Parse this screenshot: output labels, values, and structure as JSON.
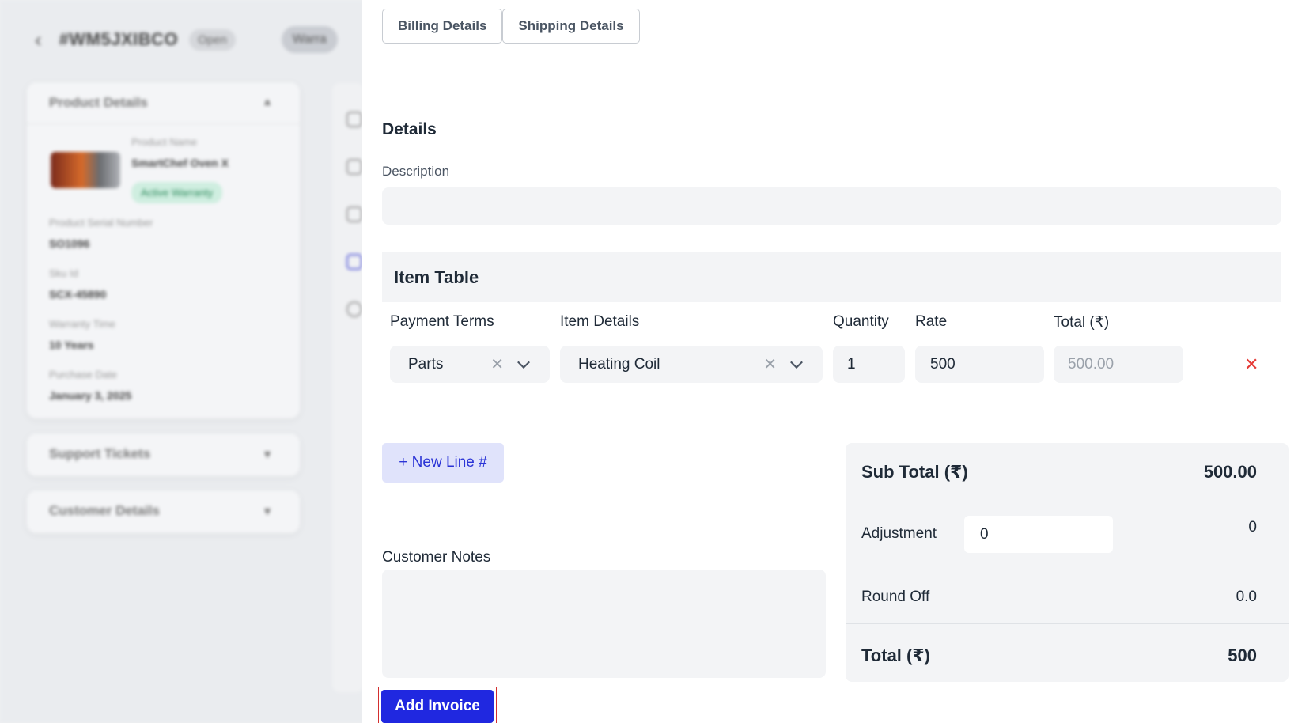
{
  "background": {
    "ticket_id": "#WM5JXIBCO",
    "status": "Open",
    "warranty_pill": "Warra",
    "product_card": {
      "title": "Product Details",
      "product_name_label": "Product Name",
      "product_name": "SmartChef Oven X",
      "warranty_badge": "Active Warranty",
      "serial_label": "Product Serial Number",
      "serial": "SO1096",
      "sku_label": "Sku Id",
      "sku": "SCX-45890",
      "warranty_time_label": "Warranty Time",
      "warranty_time": "10 Years",
      "purchase_date_label": "Purchase Date",
      "purchase_date": "January 3, 2025"
    },
    "support_card_title": "Support Tickets",
    "customer_card_title": "Customer Details"
  },
  "tabs": [
    {
      "label": "Billing Details"
    },
    {
      "label": "Shipping Details"
    }
  ],
  "details": {
    "title": "Details",
    "description_label": "Description",
    "description_value": ""
  },
  "item_table": {
    "title": "Item Table",
    "columns": [
      "Payment Terms",
      "Item Details",
      "Quantity",
      "Rate",
      "Total (₹)"
    ],
    "row": {
      "payment_terms": "Parts",
      "item_details": "Heating Coil",
      "quantity": "1",
      "rate": "500",
      "total": "500.00"
    },
    "remove_symbol": "✕"
  },
  "new_line_label": "+ New Line #",
  "customer_notes": {
    "label": "Customer Notes",
    "value": ""
  },
  "add_invoice_label": "Add Invoice",
  "summary": {
    "subtotal_label": "Sub Total (₹)",
    "subtotal_value": "500.00",
    "adjustment_label": "Adjustment",
    "adjustment_input": "0",
    "adjustment_value": "0",
    "roundoff_label": "Round Off",
    "roundoff_value": "0.0",
    "total_label": "Total (₹)",
    "total_value": "500"
  },
  "colors": {
    "primary": "#2028e0",
    "danger": "#e53935",
    "field_bg": "#f3f4f6"
  }
}
